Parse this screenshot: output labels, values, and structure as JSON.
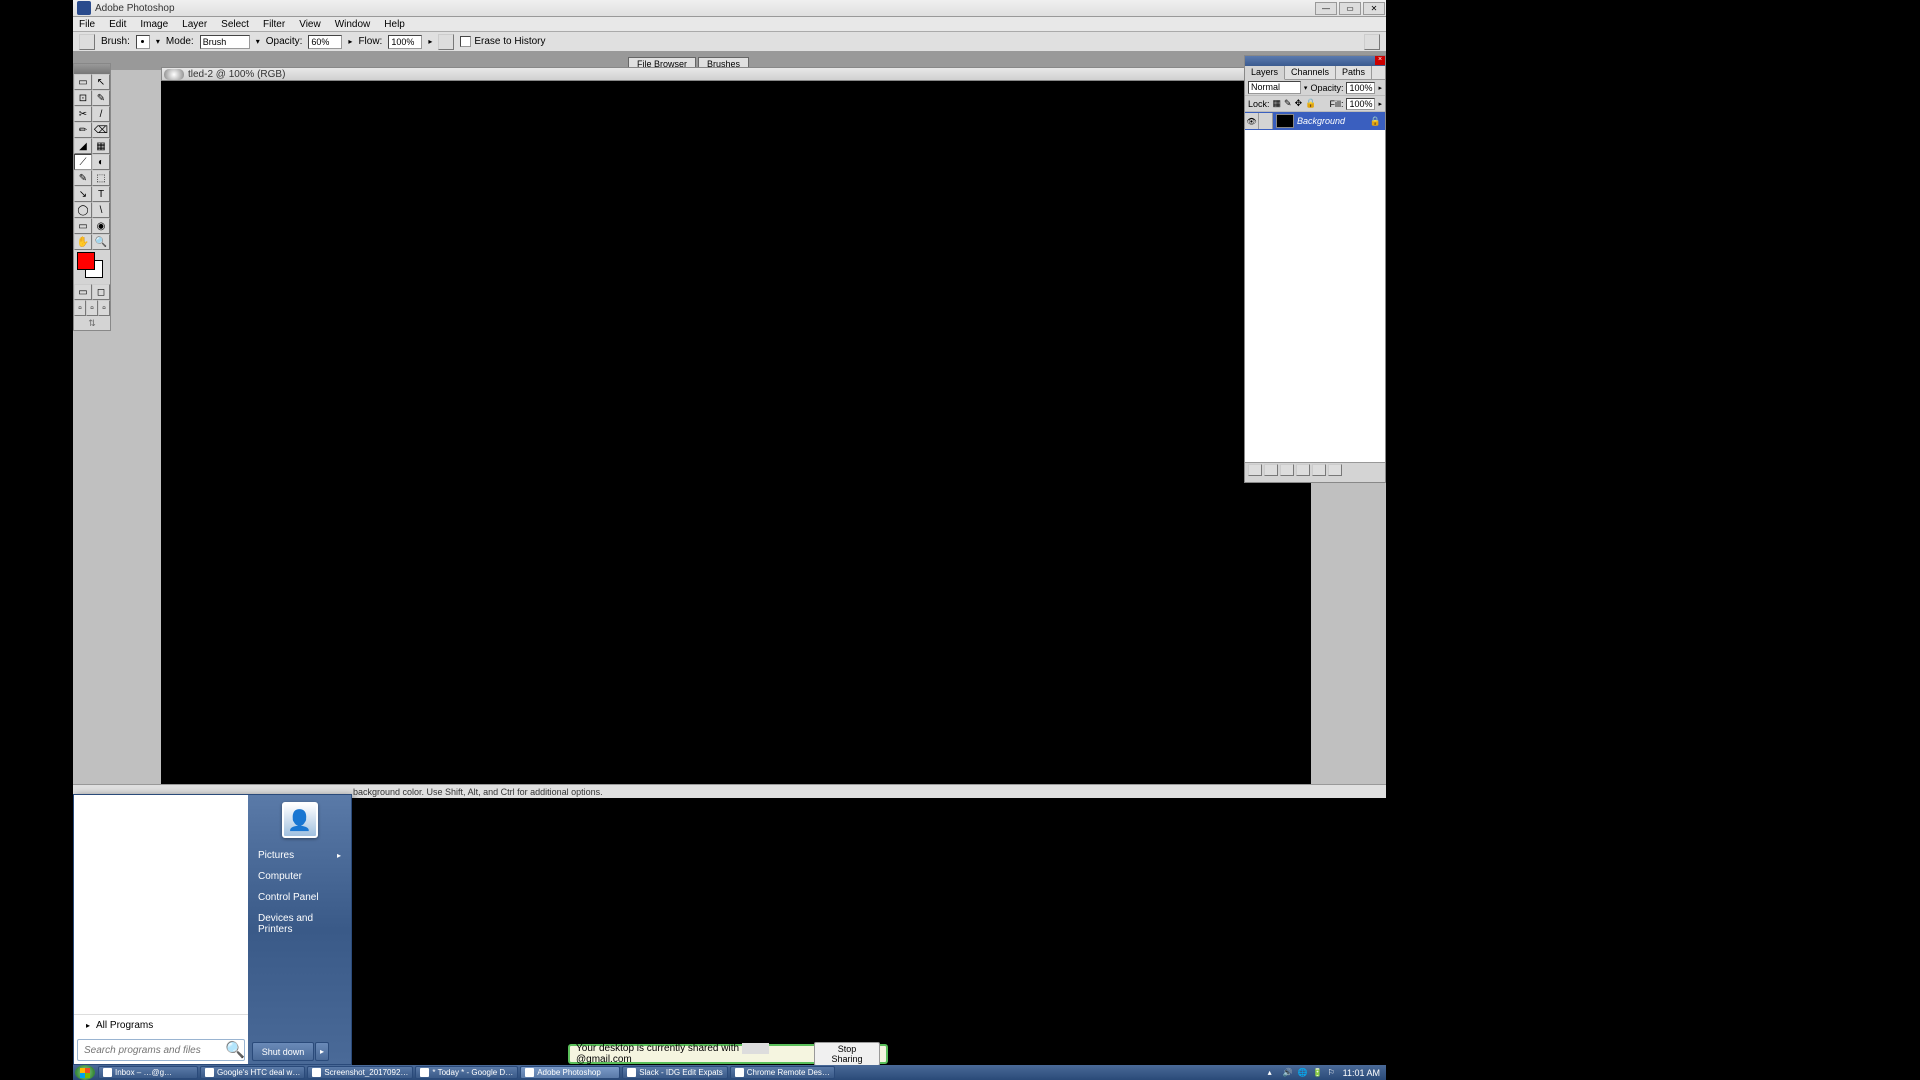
{
  "app": {
    "title": "Adobe Photoshop",
    "menu": [
      "File",
      "Edit",
      "Image",
      "Layer",
      "Select",
      "Filter",
      "View",
      "Window",
      "Help"
    ]
  },
  "options": {
    "brush_label": "Brush:",
    "mode_label": "Mode:",
    "mode_value": "Brush",
    "opacity_label": "Opacity:",
    "opacity_value": "60%",
    "flow_label": "Flow:",
    "flow_value": "100%",
    "erase_label": "Erase to History"
  },
  "tabs": {
    "file_browser": "File Browser",
    "brushes": "Brushes"
  },
  "doc": {
    "title": "tled-2 @ 100% (RGB)"
  },
  "tools": [
    "▭",
    "↖",
    "⊡",
    "✎",
    "✂",
    "/",
    "✏",
    "⌫",
    "◢",
    "▦",
    "⟋",
    "◐",
    "✎",
    "⬚",
    "↘",
    "T",
    "◯",
    "\\",
    "▭",
    "◉",
    "✋",
    "🔍"
  ],
  "colors": {
    "fg": "#ff0000",
    "bg": "#ffffff"
  },
  "panel": {
    "tabs": [
      "Layers",
      "Channels",
      "Paths"
    ],
    "blend_label": "Normal",
    "opacity_label": "Opacity:",
    "opacity_value": "100%",
    "lock_label": "Lock:",
    "fill_label": "Fill:",
    "fill_value": "100%",
    "layer_name": "Background"
  },
  "status": {
    "text": "background color. Use Shift, Alt, and Ctrl for additional options."
  },
  "start": {
    "right_items": [
      "Pictures",
      "Computer",
      "Control Panel",
      "Devices and Printers"
    ],
    "all_programs": "All Programs",
    "search_placeholder": "Search programs and files",
    "shutdown": "Shut down"
  },
  "share": {
    "text_prefix": "Your desktop is currently shared with ",
    "email": "@gmail.com",
    "button": "Stop Sharing"
  },
  "taskbar": {
    "items": [
      "Inbox – …@g…",
      "Google's HTC deal w…",
      "Screenshot_2017092…",
      "* Today * - Google D…",
      "Adobe Photoshop",
      "Slack - IDG Edit Expats",
      "Chrome Remote Des…"
    ],
    "time": "11:01 AM"
  }
}
